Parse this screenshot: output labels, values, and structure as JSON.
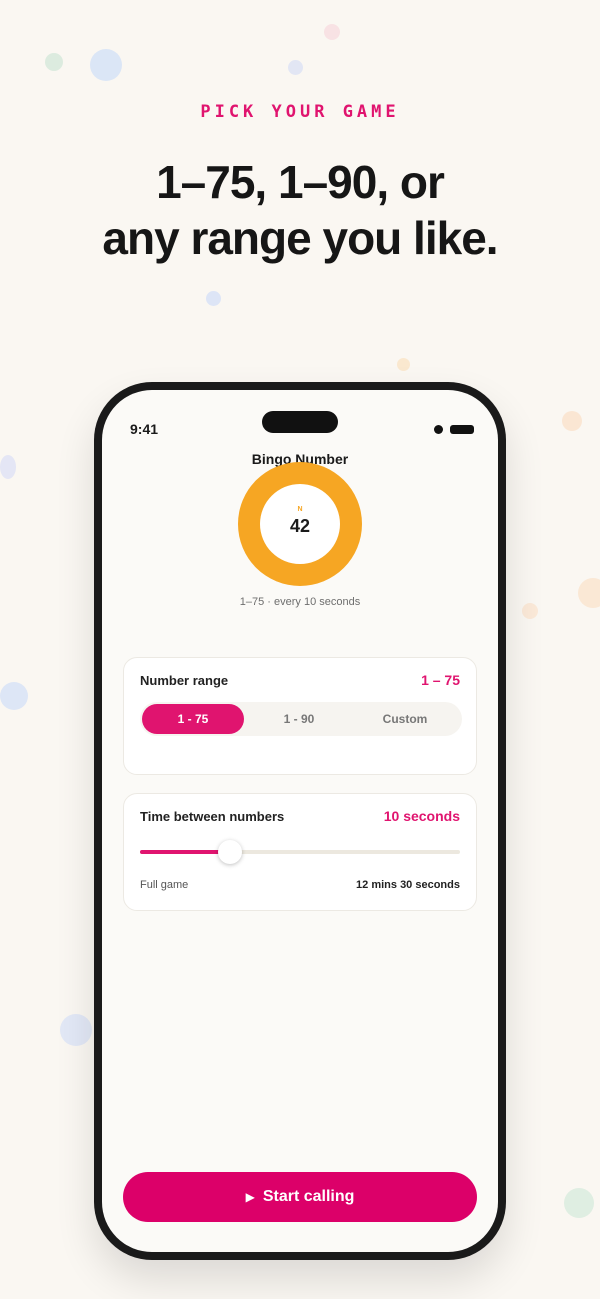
{
  "marketing": {
    "eyebrow": "PICK YOUR GAME",
    "headline_line1": "1–75, 1–90, or",
    "headline_line2": "any range you like."
  },
  "status_bar": {
    "time": "9:41"
  },
  "app": {
    "title": "Bingo Number",
    "ball": {
      "letter": "N",
      "number": "42",
      "color": "#f6a623"
    },
    "subline": "1–75  ·  every 10 seconds"
  },
  "number_range": {
    "label": "Number range",
    "value": "1 – 75",
    "options": [
      "1 - 75",
      "1 - 90",
      "Custom"
    ],
    "selected": "1 - 75"
  },
  "timing": {
    "label": "Time between numbers",
    "value": "10 seconds",
    "slider_fraction": 0.28,
    "full_game_label": "Full game",
    "full_game_value": "12 mins 30 seconds"
  },
  "actions": {
    "start_label": "Start calling",
    "start_icon": "play-icon"
  },
  "colors": {
    "accent": "#e0146f",
    "button": "#dc0069",
    "ball": "#f6a623",
    "background": "#faf7f2"
  }
}
